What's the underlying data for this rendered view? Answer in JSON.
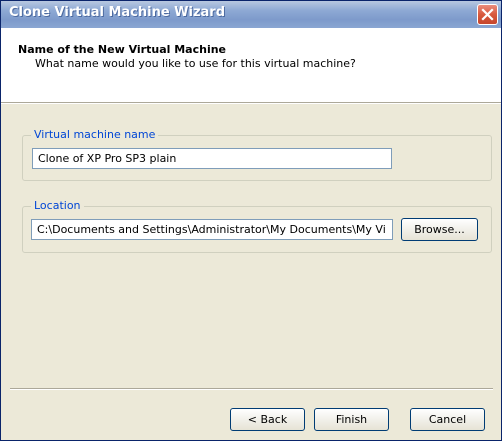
{
  "window": {
    "title": "Clone Virtual Machine Wizard",
    "close_icon": "close-icon"
  },
  "header": {
    "title": "Name of the New Virtual Machine",
    "subtitle": "What name would you like to use for this virtual machine?"
  },
  "name_group": {
    "label": "Virtual machine name",
    "value": "Clone of XP Pro SP3 plain"
  },
  "location_group": {
    "label": "Location",
    "value": "C:\\Documents and Settings\\Administrator\\My Documents\\My Vi",
    "browse_label": "Browse..."
  },
  "buttons": {
    "back_label": "< Back",
    "finish_label": "Finish",
    "cancel_label": "Cancel"
  },
  "colors": {
    "group_label": "#0046d5",
    "dialog_background": "#ece9d8",
    "close_button": "#d8593e"
  }
}
